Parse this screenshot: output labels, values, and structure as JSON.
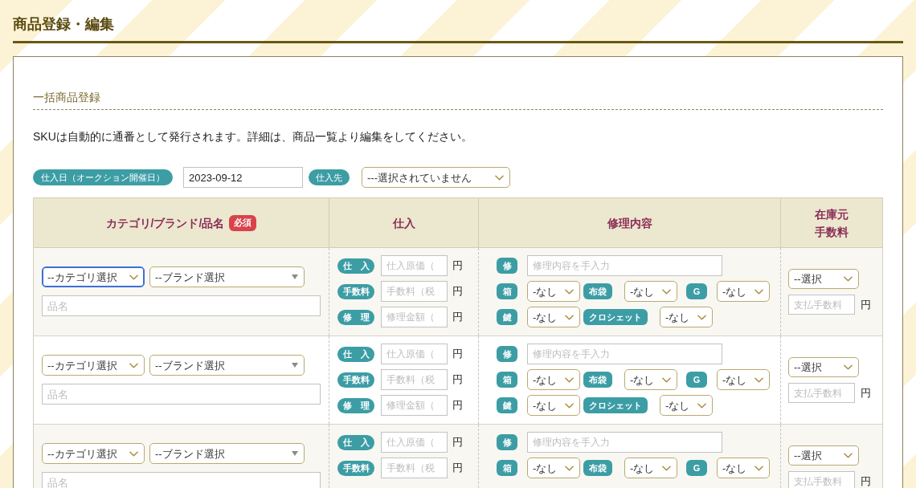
{
  "page": {
    "title": "商品登録・編集"
  },
  "section": {
    "title": "一括商品登録",
    "note": "SKUは自動的に通番として発行されます。詳細は、商品一覧より編集をしてください。"
  },
  "filters": {
    "purchase_date": {
      "label": "仕入日（オークション開催日）",
      "value": "2023-09-12"
    },
    "supplier": {
      "label": "仕入先",
      "value": "---選択されていません"
    }
  },
  "table": {
    "columns": [
      {
        "label": "カテゴリ/ブランド/品名",
        "badge": "必須"
      },
      {
        "label": "仕入"
      },
      {
        "label": "修理内容"
      },
      {
        "label": "在庫元手数料"
      }
    ],
    "rows": [
      {
        "category": {
          "value": "--カテゴリ選択",
          "focused": true
        },
        "brand": {
          "value": "--ブランド選択"
        },
        "name": {
          "placeholder": "品名"
        },
        "purchase": [
          {
            "label": "仕　入",
            "placeholder": "仕入原価（",
            "unit": "円"
          },
          {
            "label": "手数料",
            "placeholder": "手数料（税",
            "unit": "円"
          },
          {
            "label": "修　理",
            "placeholder": "修理金額（",
            "unit": "円"
          }
        ],
        "repair": [
          {
            "items": [
              {
                "kind": "badge",
                "text": "修"
              },
              {
                "kind": "input",
                "placeholder": "修理内容を手入力"
              }
            ]
          },
          {
            "items": [
              {
                "kind": "badge",
                "text": "箱"
              },
              {
                "kind": "select",
                "value": "-なし"
              },
              {
                "kind": "badge",
                "text": "布袋"
              },
              {
                "kind": "select",
                "value": "-なし"
              },
              {
                "kind": "badge",
                "text": "G"
              },
              {
                "kind": "select",
                "value": "-なし"
              }
            ]
          },
          {
            "items": [
              {
                "kind": "badge",
                "text": "鍵"
              },
              {
                "kind": "select",
                "value": "-なし"
              },
              {
                "kind": "badge",
                "text": "クロシェット"
              },
              {
                "kind": "select",
                "value": "-なし"
              }
            ]
          }
        ],
        "stock": {
          "value": "--選択",
          "fee_placeholder": "支払手数料",
          "unit": "円"
        }
      },
      {
        "category": {
          "value": "--カテゴリ選択",
          "focused": false
        },
        "brand": {
          "value": "--ブランド選択"
        },
        "name": {
          "placeholder": "品名"
        },
        "purchase": [
          {
            "label": "仕　入",
            "placeholder": "仕入原価（",
            "unit": "円"
          },
          {
            "label": "手数料",
            "placeholder": "手数料（税",
            "unit": "円"
          },
          {
            "label": "修　理",
            "placeholder": "修理金額（",
            "unit": "円"
          }
        ],
        "repair": [
          {
            "items": [
              {
                "kind": "badge",
                "text": "修"
              },
              {
                "kind": "input",
                "placeholder": "修理内容を手入力"
              }
            ]
          },
          {
            "items": [
              {
                "kind": "badge",
                "text": "箱"
              },
              {
                "kind": "select",
                "value": "-なし"
              },
              {
                "kind": "badge",
                "text": "布袋"
              },
              {
                "kind": "select",
                "value": "-なし"
              },
              {
                "kind": "badge",
                "text": "G"
              },
              {
                "kind": "select",
                "value": "-なし"
              }
            ]
          },
          {
            "items": [
              {
                "kind": "badge",
                "text": "鍵"
              },
              {
                "kind": "select",
                "value": "-なし"
              },
              {
                "kind": "badge",
                "text": "クロシェット"
              },
              {
                "kind": "select",
                "value": "-なし"
              }
            ]
          }
        ],
        "stock": {
          "value": "--選択",
          "fee_placeholder": "支払手数料",
          "unit": "円"
        }
      },
      {
        "category": {
          "value": "--カテゴリ選択",
          "focused": false
        },
        "brand": {
          "value": "--ブランド選択"
        },
        "name": {
          "placeholder": "品名"
        },
        "purchase": [
          {
            "label": "仕　入",
            "placeholder": "仕入原価（",
            "unit": "円"
          },
          {
            "label": "手数料",
            "placeholder": "手数料（税",
            "unit": "円"
          }
        ],
        "repair": [
          {
            "items": [
              {
                "kind": "badge",
                "text": "修"
              },
              {
                "kind": "input",
                "placeholder": "修理内容を手入力"
              }
            ]
          },
          {
            "items": [
              {
                "kind": "badge",
                "text": "箱"
              },
              {
                "kind": "select",
                "value": "-なし"
              },
              {
                "kind": "badge",
                "text": "布袋"
              },
              {
                "kind": "select",
                "value": "-なし"
              },
              {
                "kind": "badge",
                "text": "G"
              },
              {
                "kind": "select",
                "value": "-なし"
              }
            ]
          }
        ],
        "stock": {
          "value": "--選択",
          "fee_placeholder": "支払手数料",
          "unit": "円"
        }
      }
    ]
  }
}
